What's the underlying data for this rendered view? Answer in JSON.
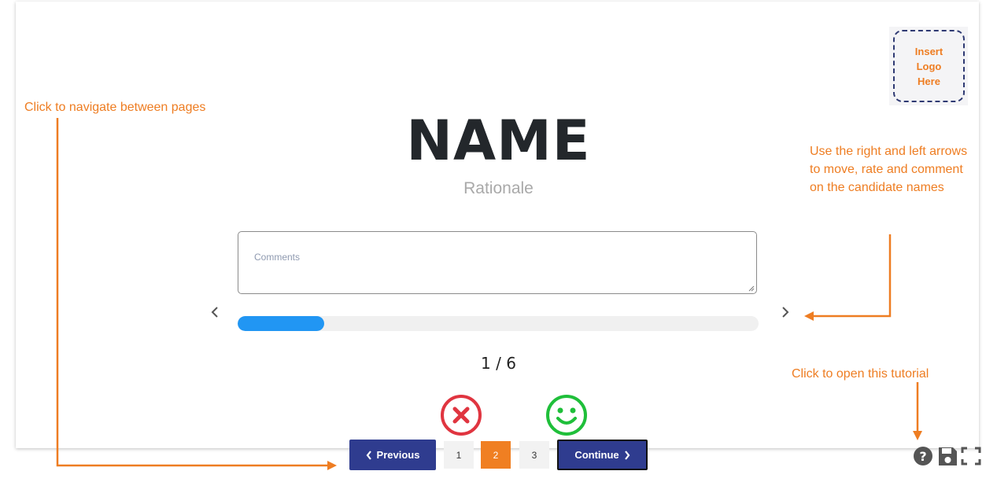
{
  "logo": {
    "text": "Insert\nLogo\nHere"
  },
  "main": {
    "name": "NAME",
    "rationale": "Rationale",
    "comments_placeholder": "Comments",
    "counter": "1 / 6",
    "progress_fraction": 0.1667
  },
  "rating": {
    "reject_icon": "x-circle-icon",
    "accept_icon": "smiley-icon",
    "reject_color": "#e03540",
    "accept_color": "#1fbf3a"
  },
  "pagination": {
    "previous_label": "Previous",
    "continue_label": "Continue",
    "pages": [
      "1",
      "2",
      "3"
    ],
    "active_page": "2",
    "accent": "#2f3c8f",
    "active_color": "#f07f22"
  },
  "annotations": {
    "navigate": "Click to navigate between pages",
    "arrows": "Use the right and left arrows to move, rate and comment on the candidate names",
    "tutorial": "Click to open this tutorial",
    "color": "#ee7d22"
  },
  "toolbar": {
    "icons": [
      "help-icon",
      "save-icon",
      "fullscreen-icon"
    ]
  }
}
